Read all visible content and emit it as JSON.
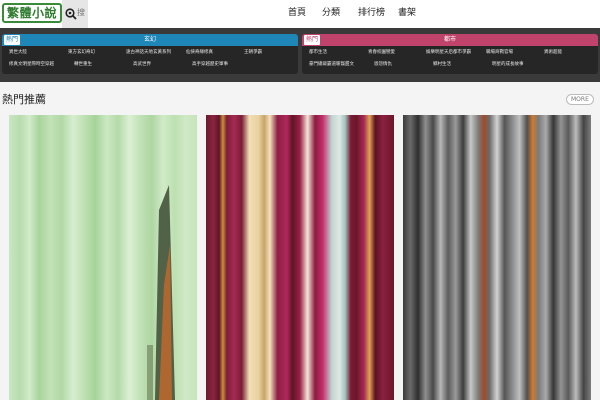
{
  "header": {
    "logo_text": "繁體小說",
    "search_label": "搜",
    "nav": [
      {
        "label": "首頁"
      },
      {
        "label": "分類"
      },
      {
        "label": "排行榜"
      },
      {
        "label": "書架"
      }
    ]
  },
  "categories": [
    {
      "tag": "熱門",
      "title": "玄幻",
      "accent": "#1f86b8",
      "links": [
        [
          "異世大陸",
          "東方玄幻奇幻",
          "遠古神話天地玄黃系列",
          "仙俠奇緣修真",
          "王朝爭霸"
        ],
        [
          "修真文明星際時空穿越",
          "轉世重生",
          "高武世界",
          "高手穿越歷史軍事"
        ]
      ]
    },
    {
      "tag": "熱門",
      "title": "都市",
      "accent": "#c0436c",
      "links": [
        [
          "都市生活",
          "青春校園戀愛",
          "娛樂明星天后都市爭霸",
          "職場商戰官場",
          "異術超能"
        ],
        [
          "豪門總裁霸道暖寵甜文",
          "恩怨情仇",
          "鄉村生活",
          "明星的成長故事"
        ]
      ]
    }
  ],
  "section": {
    "title": "熱門推薦",
    "more_label": "MORE"
  },
  "colors": {
    "topbar_bg": "#ffffff",
    "panel_bg": "#3a3a3a",
    "logo_green": "#2f7d2f"
  }
}
